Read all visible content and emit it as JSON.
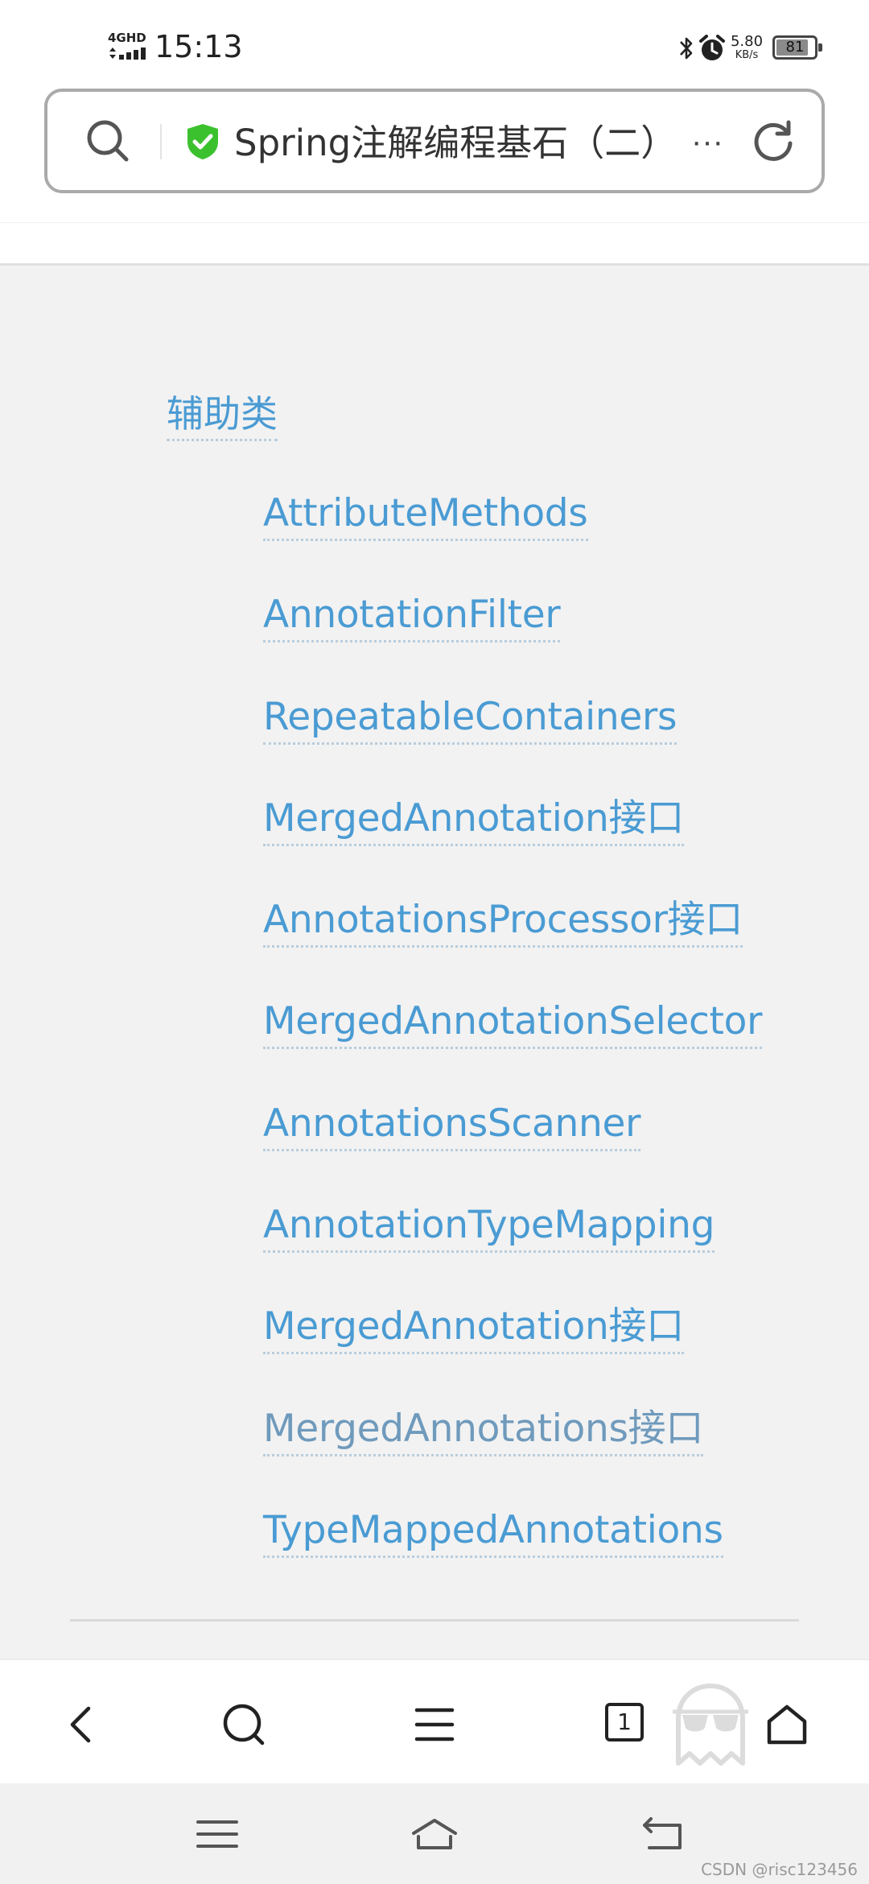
{
  "status_bar": {
    "network": "4GHD",
    "time": "15:13",
    "speed_value": "5.80",
    "speed_unit": "KB/s",
    "battery": "81"
  },
  "address_bar": {
    "title": "Spring注解编程基石（二）",
    "more": "···"
  },
  "toc": {
    "heading": "辅助类",
    "items": [
      "AttributeMethods",
      "AnnotationFilter",
      "RepeatableContainers",
      "MergedAnnotation接口",
      "AnnotationsProcessor接口",
      "MergedAnnotationSelector",
      "AnnotationsScanner",
      "AnnotationTypeMapping",
      "MergedAnnotation接口",
      "MergedAnnotations接口",
      "TypeMappedAnnotations"
    ]
  },
  "browser_nav": {
    "tab_count": "1"
  },
  "watermark": "CSDN @risc123456",
  "colors": {
    "link": "#4a9bd3",
    "secure": "#3cc12e",
    "background": "#f2f2f2"
  }
}
